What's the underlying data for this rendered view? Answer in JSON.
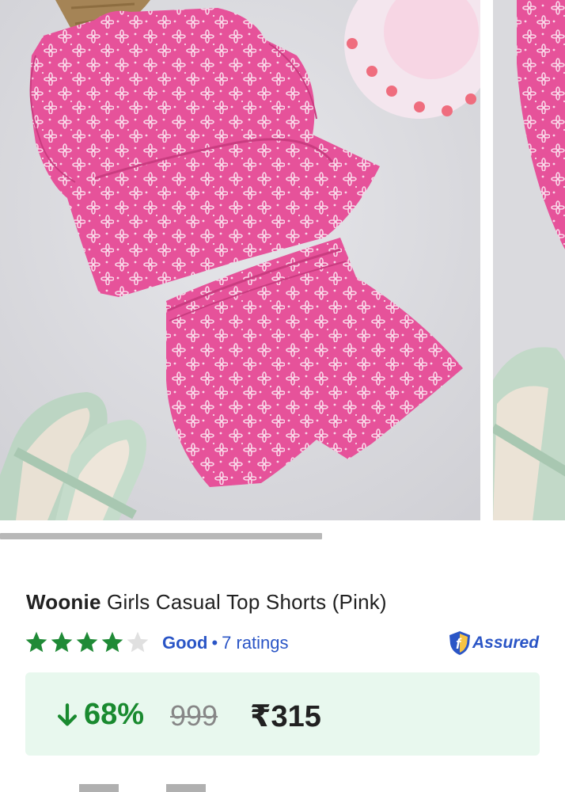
{
  "product": {
    "brand": "Woonie",
    "name": " Girls Casual Top Shorts (Pink)"
  },
  "rating": {
    "stars": 4,
    "max_stars": 5,
    "label": "Good",
    "separator": "•",
    "count_text": "7 ratings",
    "star_color": "#1f8a36"
  },
  "assured": {
    "label": "Assured"
  },
  "pricing": {
    "discount": "68%",
    "mrp": "999",
    "price": "₹315"
  },
  "carousel": {
    "active_fraction": 0.57
  },
  "colors": {
    "accent_blue": "#2a55c6",
    "discount_green": "#198a2f",
    "price_box_bg": "#e8f8ee",
    "garment_pink": "#e8559a"
  }
}
